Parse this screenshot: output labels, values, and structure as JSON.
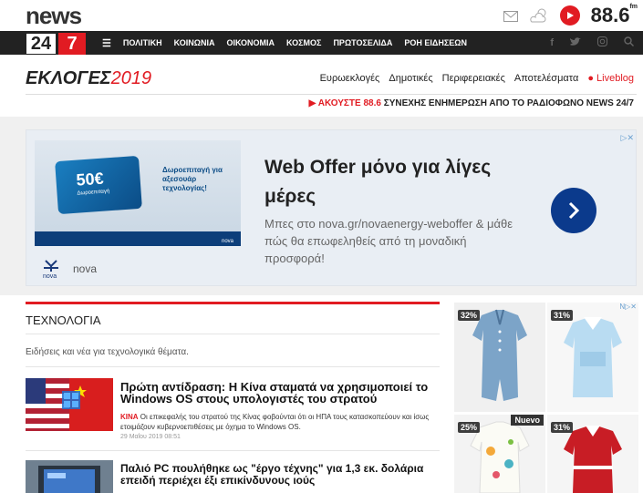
{
  "header": {
    "logo_news": "news",
    "logo_24": "24",
    "logo_7": "7",
    "radio_freq": "88.6",
    "radio_suffix": "fm"
  },
  "nav": {
    "items": [
      "ΠΟΛΙΤΙΚΗ",
      "ΚΟΙΝΩΝΙΑ",
      "ΟΙΚΟΝΟΜΙΑ",
      "ΚΟΣΜΟΣ",
      "ΠΡΩΤΟΣΕΛΙΔΑ",
      "ΡΟΗ ΕΙΔΗΣΕΩΝ"
    ]
  },
  "elections": {
    "title_prefix": "ΕΚΛΟΓΕΣ",
    "title_year": "2019",
    "links": [
      "Ευρωεκλογές",
      "Δημοτικές",
      "Περιφερειακές",
      "Αποτελέσματα"
    ],
    "live": "Liveblog"
  },
  "listen_bar": {
    "prefix": "ΑΚΟΥΣΤΕ 88.6",
    "text": "ΣΥΝΕΧΗΣ ΕΝΗΜΕΡΩΣΗ ΑΠΟ ΤΟ ΡΑΔΙΟΦΩΝΟ NEWS 24/7"
  },
  "ad": {
    "card_value": "50€",
    "card_caption": "Δωροεπιταγή",
    "image_text": "Δωροεπιταγή για αξεσουάρ τεχνολογίας!",
    "image_brand": "nova",
    "title": "Web Offer μόνο για λίγες μέρες",
    "description": "Μπες στο nova.gr/novaenergy-weboffer & μάθε πώς θα επωφεληθείς από τη μοναδική προσφορά!",
    "brand": "nova"
  },
  "section": {
    "title": "ΤΕΧΝΟΛΟΓΙΑ",
    "description": "Ειδήσεις και νέα για τεχνολογικά θέματα."
  },
  "articles": [
    {
      "title": "Πρώτη αντίδραση: Η Κίνα σταματά να χρησιμοποιεί το Windows OS στους υπολογιστές του στρατού",
      "tag": "ΚΙΝΑ",
      "summary": "Οι επικεφαλής του στρατού της Κίνας φοβούνται ότι οι ΗΠΑ τους κατασκοπεύουν και ίσως ετοιμάζουν κυβερνοεπιθέσεις με όχημα το Windows OS.",
      "date": "29 Μαΐου 2019 08:51"
    },
    {
      "title": "Παλιό PC πουλήθηκε ως \"έργο τέχνης\" για 1,3 εκ. δολάρια επειδή περιέχει έξι επικίνδυνους ιούς"
    }
  ],
  "products": [
    {
      "discount": "32%"
    },
    {
      "discount": "31%"
    },
    {
      "discount": "25%",
      "badge": "Nuevo"
    },
    {
      "discount": "31%"
    }
  ]
}
